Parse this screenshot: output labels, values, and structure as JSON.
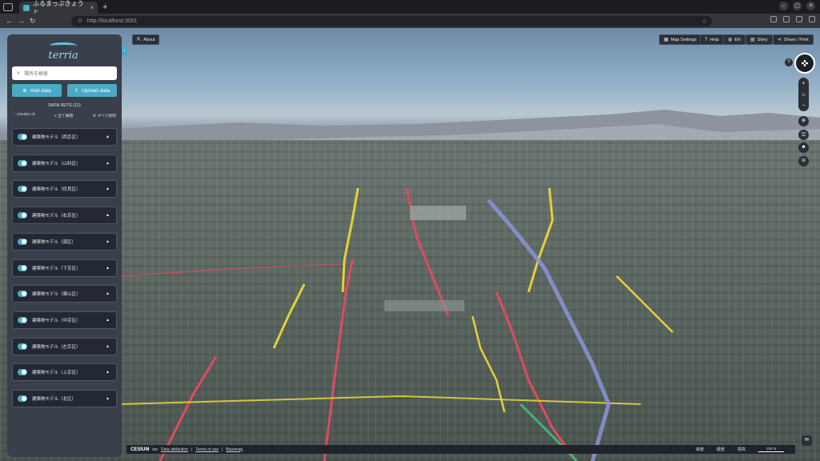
{
  "browser": {
    "tab_title": "ふるまっぷきょうと",
    "tab_close": "×",
    "new_tab": "+",
    "url": "http://localhost:3001"
  },
  "sidebar": {
    "logo_text": "terria",
    "search_placeholder": "場所を検索",
    "add_data": "Add data",
    "upload_data": "Upload data",
    "datasets_title": "DATA SETS (11)",
    "actions": {
      "disable_all": "Disable All",
      "expand_all": "全て展開",
      "remove_all": "すべて削除"
    },
    "datasets": [
      "建築物モデル（西京区）",
      "建築物モデル（山科区）",
      "建築物モデル（伏見区）",
      "建築物モデル（右京区）",
      "建築物モデル（南区）",
      "建築物モデル（下京区）",
      "建築物モデル（東山区）",
      "建築物モデル（中京区）",
      "建築物モデル（左京区）",
      "建築物モデル（上京区）",
      "建築物モデル（北区）"
    ]
  },
  "toolbar": {
    "about": "About",
    "map_settings": "Map Settings",
    "help": "Help",
    "lang": "EN",
    "story": "Story",
    "share": "Share / Print"
  },
  "bottom": {
    "cesium": "CESIUM",
    "ion": "ion",
    "attribution": "Data attribution",
    "terms": "Terms of use",
    "basemap": "Basemap",
    "lat": "緯度",
    "lon": "経度",
    "elev": "標高",
    "scale": "100 m"
  },
  "colors": {
    "accent": "#4aa9c6",
    "panel": "#3a3f4c",
    "road_major": "#e04a5f",
    "road_secondary": "#e2d13a"
  }
}
